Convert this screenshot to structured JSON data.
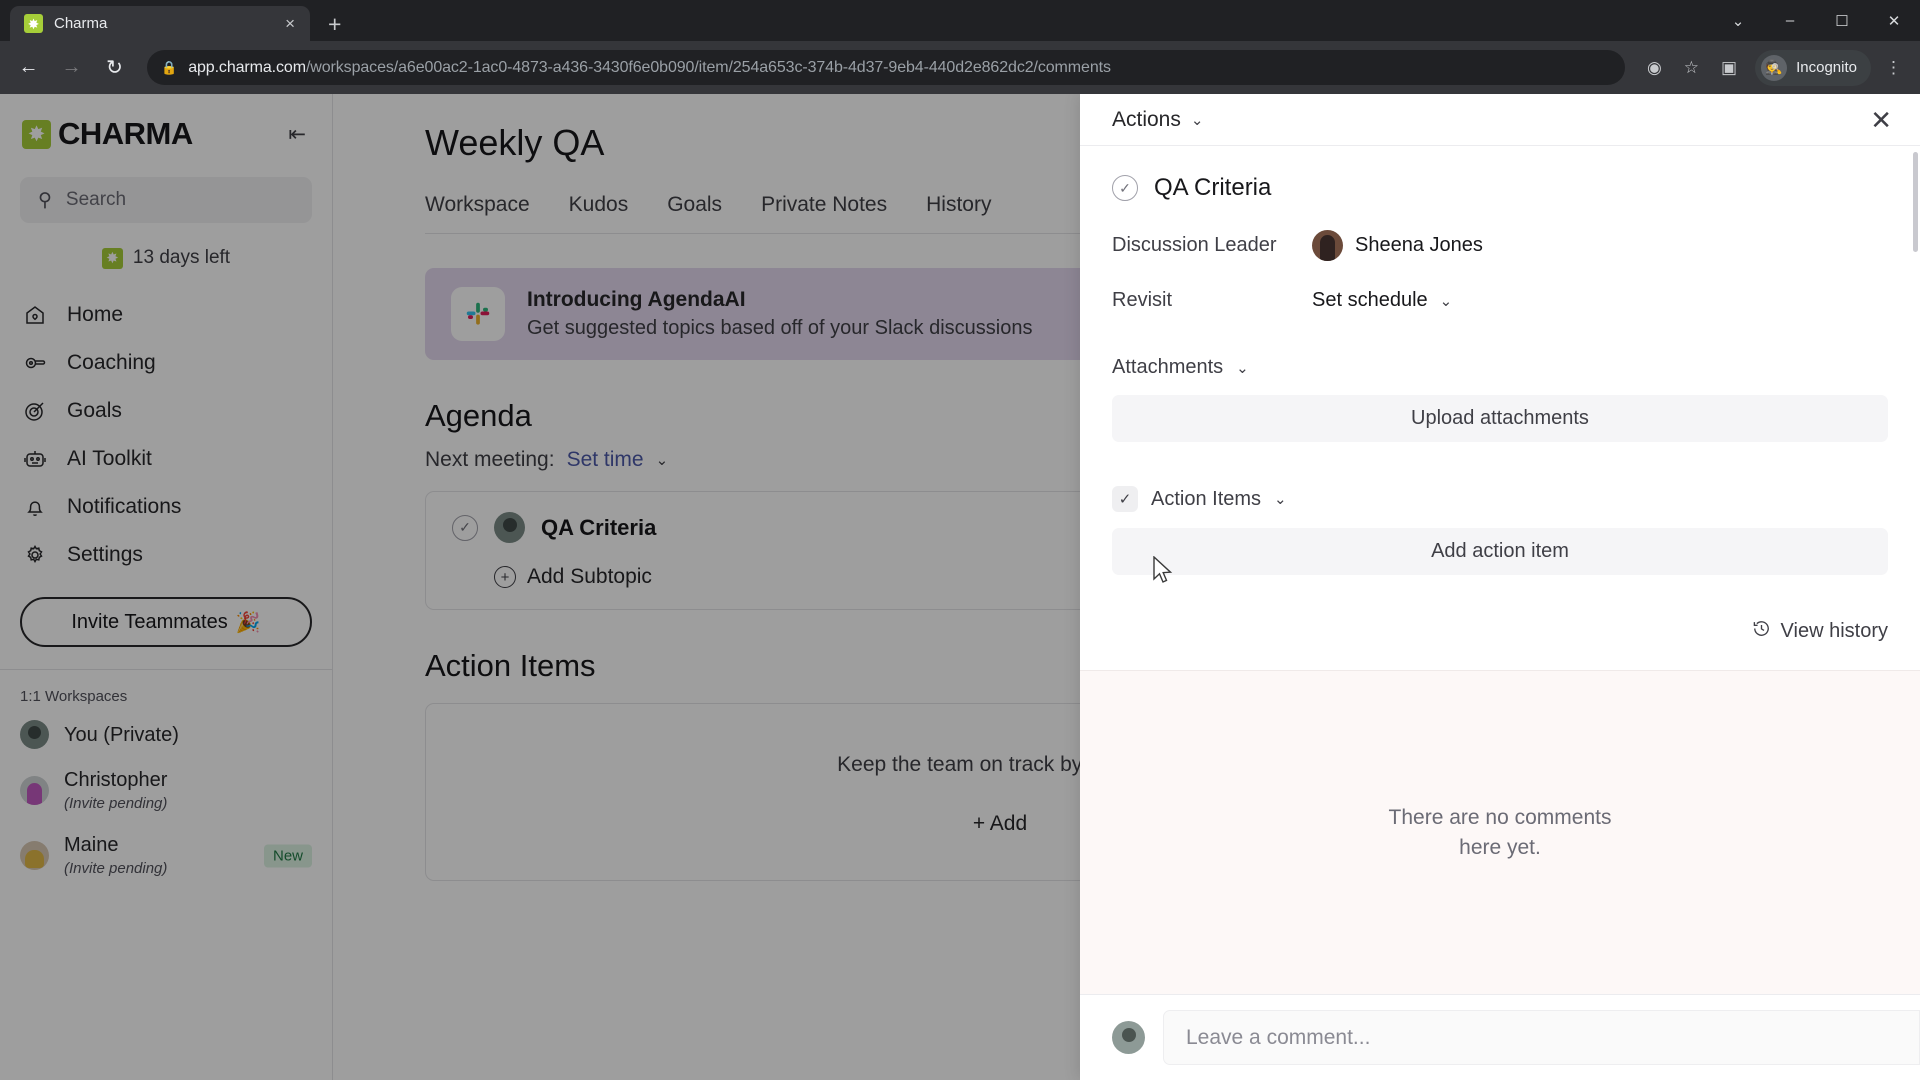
{
  "browser": {
    "tab": {
      "title": "Charma",
      "favicon": "charma-logo-icon",
      "close": "×"
    },
    "new_tab_label": "+",
    "window_controls": {
      "minimize": "–",
      "maximize": "☐",
      "close": "✕",
      "chevron": "⌄"
    },
    "nav": {
      "back": "←",
      "forward": "→",
      "reload": "↻"
    },
    "omnibox": {
      "lock": "🔒",
      "host": "app.charma.com",
      "path": "/workspaces/a6e00ac2-1ac0-4873-a436-3430f6e0b090/item/254a653c-374b-4d37-9eb4-440d2e862dc2/comments"
    },
    "toolbar_icons": {
      "tracking": "◉",
      "bookmark": "☆",
      "side_panel": "▣",
      "menu": "⋮"
    },
    "profile": {
      "label": "Incognito",
      "avatar_glyph": "🕵"
    }
  },
  "sidebar": {
    "brand": {
      "name": "CHARMA",
      "mark": "✸"
    },
    "collapse_icon": "⇤",
    "search": {
      "placeholder": "Search",
      "icon": "search-icon"
    },
    "trial": {
      "text": "13 days left",
      "badge": "✸"
    },
    "nav_items": [
      {
        "label": "Home",
        "icon": "home-icon"
      },
      {
        "label": "Coaching",
        "icon": "whistle-icon"
      },
      {
        "label": "Goals",
        "icon": "target-icon"
      },
      {
        "label": "AI Toolkit",
        "icon": "robot-icon"
      },
      {
        "label": "Notifications",
        "icon": "bell-icon"
      },
      {
        "label": "Settings",
        "icon": "gear-icon"
      }
    ],
    "invite_button": {
      "label": "Invite Teammates",
      "emoji": "🎉"
    },
    "workspaces_label": "1:1 Workspaces",
    "workspaces": [
      {
        "name": "You (Private)",
        "sub": "",
        "badge": ""
      },
      {
        "name": "Christopher",
        "sub": "(Invite pending)",
        "badge": ""
      },
      {
        "name": "Maine",
        "sub": "(Invite pending)",
        "badge": "New"
      }
    ]
  },
  "main": {
    "title": "Weekly QA",
    "tabs": [
      "Workspace",
      "Kudos",
      "Goals",
      "Private Notes",
      "History"
    ],
    "promo": {
      "title": "Introducing AgendaAI",
      "subtitle": "Get suggested topics based off of your Slack discussions",
      "icon": "slack-icon"
    },
    "agenda": {
      "heading": "Agenda",
      "next_meeting_label": "Next meeting:",
      "next_meeting_value": "Set time",
      "items": [
        {
          "title": "QA Criteria"
        }
      ],
      "add_subtopic": "Add Subtopic"
    },
    "action_items": {
      "heading": "Action Items",
      "empty_text": "Keep the team on track by creating",
      "add_label": "Add"
    }
  },
  "panel": {
    "actions_label": "Actions",
    "close_icon": "✕",
    "item_title": "QA Criteria",
    "fields": [
      {
        "label": "Discussion Leader",
        "value": "Sheena Jones",
        "type": "avatar"
      },
      {
        "label": "Revisit",
        "value": "Set schedule",
        "type": "dropdown"
      }
    ],
    "attachments": {
      "label": "Attachments",
      "button": "Upload attachments"
    },
    "action_items": {
      "label": "Action Items",
      "button": "Add action item"
    },
    "view_history": {
      "label": "View history",
      "icon": "history-icon"
    },
    "comments": {
      "empty_line1": "There are no comments",
      "empty_line2": "here yet."
    },
    "comment_input_placeholder": "Leave a comment..."
  }
}
